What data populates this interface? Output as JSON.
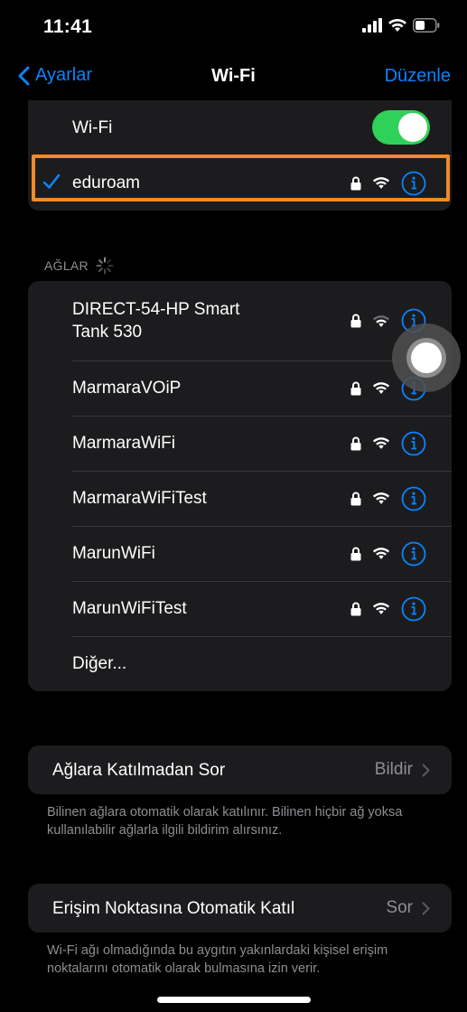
{
  "status_bar": {
    "time": "11:41"
  },
  "nav": {
    "back_label": "Ayarlar",
    "title": "Wi-Fi",
    "edit_label": "Düzenle"
  },
  "wifi_toggle": {
    "label": "Wi-Fi",
    "on": true
  },
  "connected": {
    "name": "eduroam"
  },
  "networks_header": "AĞLAR",
  "networks": [
    {
      "name": "DIRECT-54-HP Smart\nTank 530",
      "secured": true
    },
    {
      "name": "MarmaraVOiP",
      "secured": true
    },
    {
      "name": "MarmaraWiFi",
      "secured": true
    },
    {
      "name": "MarmaraWiFiTest",
      "secured": true
    },
    {
      "name": "MarunWiFi",
      "secured": true
    },
    {
      "name": "MarunWiFiTest",
      "secured": true
    }
  ],
  "other_label": "Diğer...",
  "ask_join": {
    "label": "Ağlara Katılmadan Sor",
    "value": "Bildir",
    "footnote": "Bilinen ağlara otomatik olarak katılınır. Bilinen hiçbir ağ yoksa kullanılabilir ağlarla ilgili bildirim alırsınız."
  },
  "auto_join_hotspot": {
    "label": "Erişim Noktasına Otomatik Katıl",
    "value": "Sor",
    "footnote": "Wi-Fi ağı olmadığında bu aygıtın yakınlardaki kişisel erişim noktalarını otomatik olarak bulmasına izin verir."
  },
  "colors": {
    "accent": "#0a84ff",
    "toggle_on": "#30d158",
    "highlight": "#f08a2a",
    "cell_bg": "#1c1c1e"
  }
}
